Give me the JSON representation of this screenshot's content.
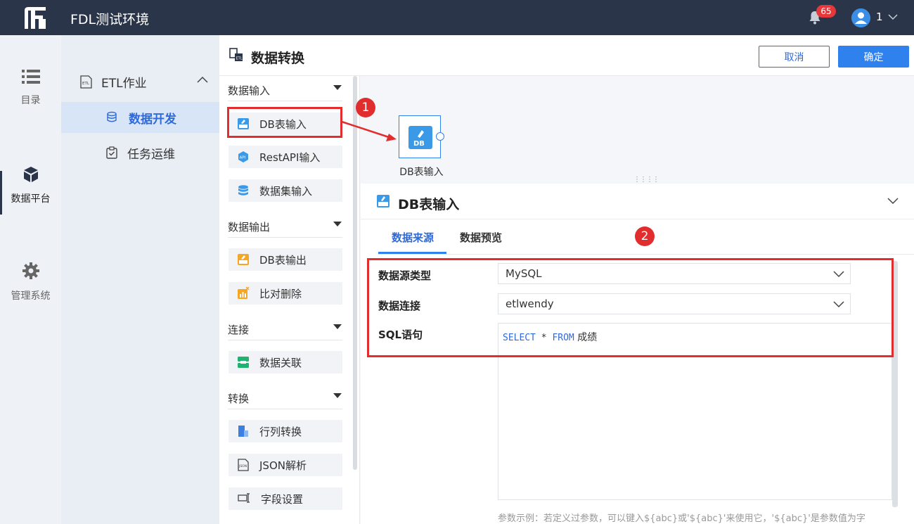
{
  "topbar": {
    "app_title": "FDL测试环境",
    "notification_count": "65",
    "user_name": "1"
  },
  "rail": {
    "items": [
      {
        "label": "目录",
        "icon": "list-icon"
      },
      {
        "label": "数据平台",
        "icon": "cube-icon",
        "active": true
      },
      {
        "label": "管理系统",
        "icon": "gear-icon"
      }
    ]
  },
  "nav": {
    "group_label": "ETL作业",
    "items": [
      {
        "label": "数据开发",
        "icon": "database-icon",
        "active": true
      },
      {
        "label": "任务运维",
        "icon": "clipboard-check-icon"
      }
    ]
  },
  "page": {
    "title": "数据转换",
    "cancel_label": "取消",
    "ok_label": "确定"
  },
  "palette": {
    "sections": [
      {
        "label": "数据输入",
        "items": [
          "DB表输入",
          "RestAPI输入",
          "数据集输入"
        ]
      },
      {
        "label": "数据输出",
        "items": [
          "DB表输出",
          "比对删除"
        ]
      },
      {
        "label": "连接",
        "items": [
          "数据关联"
        ]
      },
      {
        "label": "转换",
        "items": [
          "行列转换",
          "JSON解析",
          "字段设置"
        ]
      }
    ]
  },
  "canvas": {
    "node_label": "DB表输入",
    "node_icon_text": "DB"
  },
  "detail": {
    "title": "DB表输入",
    "tabs": [
      "数据来源",
      "数据预览"
    ],
    "active_tab": "数据来源",
    "fields": {
      "source_type_label": "数据源类型",
      "source_type_value": "MySQL",
      "connection_label": "数据连接",
      "connection_value": "etlwendy",
      "sql_label": "SQL语句",
      "sql_kw1": "SELECT",
      "sql_star": " * ",
      "sql_kw2": "FROM",
      "sql_table": " 成绩"
    },
    "hint": "参数示例：若定义过参数，可以键入${abc}或'${abc}'来使用它，'${abc}'是参数值为字"
  },
  "annotations": {
    "marker1": "1",
    "marker2": "2"
  },
  "colors": {
    "topbar": "#2b3549",
    "accent": "#2f81ee",
    "annotation": "#e12d2d"
  }
}
